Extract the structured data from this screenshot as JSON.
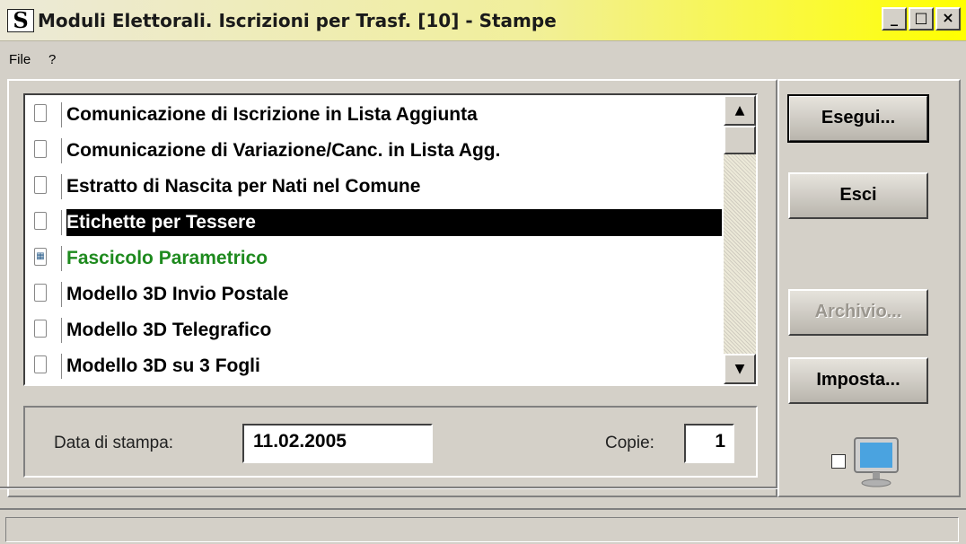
{
  "window": {
    "title": "Moduli Elettorali. Iscrizioni per Trasf. [10] - Stampe",
    "icon_letter": "S",
    "controls": {
      "minimize": "_",
      "maximize": "□",
      "close": "×"
    }
  },
  "menu": {
    "file": "File",
    "help": "?"
  },
  "list": {
    "items": [
      {
        "label": "Comunicazione di Iscrizione in Lista Aggiunta",
        "state": "normal"
      },
      {
        "label": "Comunicazione di Variazione/Canc. in Lista Agg.",
        "state": "normal"
      },
      {
        "label": "Estratto di Nascita per Nati nel Comune",
        "state": "normal"
      },
      {
        "label": "Etichette per Tessere",
        "state": "selected"
      },
      {
        "label": "Fascicolo Parametrico",
        "state": "parametric"
      },
      {
        "label": "Modello 3D Invio Postale",
        "state": "normal"
      },
      {
        "label": "Modello 3D Telegrafico",
        "state": "normal"
      },
      {
        "label": "Modello 3D su 3 Fogli",
        "state": "normal"
      }
    ],
    "scroll_up": "▲",
    "scroll_down": "▼"
  },
  "form": {
    "date_label": "Data di stampa:",
    "date_value": "11.02.2005",
    "copies_label": "Copie:",
    "copies_value": "1"
  },
  "buttons": {
    "esegui": "Esegui...",
    "esci": "Esci",
    "archivio": "Archivio...",
    "imposta": "Imposta..."
  },
  "colors": {
    "selected_bg": "#000000",
    "parametric_text": "#1e8a1e",
    "face": "#d4d0c8"
  },
  "icons": {
    "item_checkbox": "document-checkbox-icon",
    "parametric_item": "param-doc-icon",
    "preview": "monitor-icon"
  }
}
